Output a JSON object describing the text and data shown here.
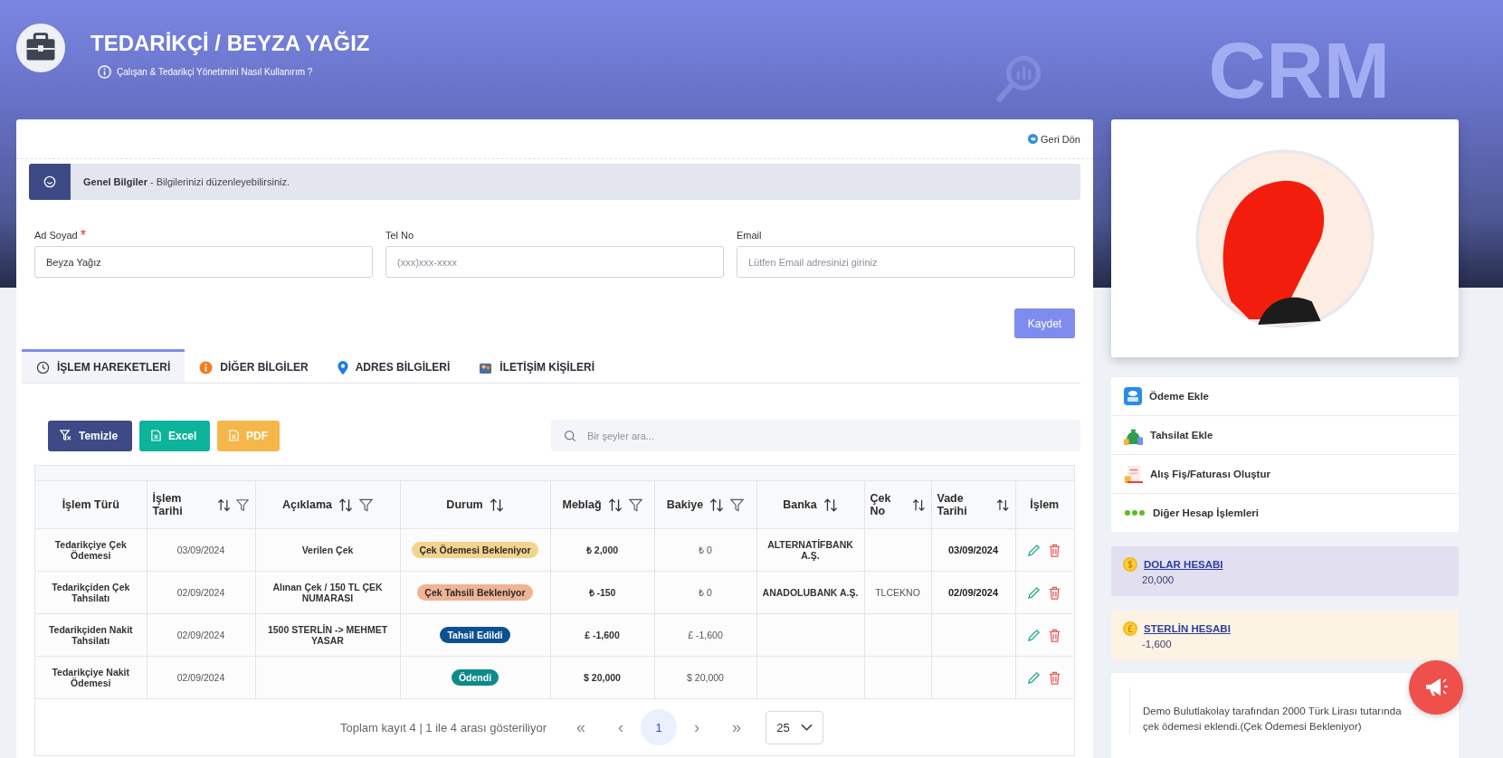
{
  "header": {
    "title": "TEDARİKÇİ / BEYZA YAĞIZ",
    "help_link": "Çalışan & Tedarikçi Yönetimini Nasıl Kullanırım ?",
    "decoration_text": "CRM"
  },
  "back_link": "Geri Dön",
  "section": {
    "title": "Genel Bilgiler",
    "subtitle": "- Bilgilerinizi düzenleyebilirsiniz."
  },
  "form": {
    "fields": [
      {
        "label": "Ad Soyad",
        "required": true,
        "value": "Beyza Yağız"
      },
      {
        "label": "Tel No",
        "required": false,
        "placeholder": "(xxx)xxx-xxxx"
      },
      {
        "label": "Email",
        "required": false,
        "placeholder": "Lütfen Email adresinizi giriniz"
      }
    ],
    "save_button": "Kaydet"
  },
  "tabs": [
    {
      "label": "İŞLEM HAREKETLERİ",
      "selected": true,
      "kind": "history"
    },
    {
      "label": "DİĞER BİLGİLER",
      "selected": false,
      "kind": "info"
    },
    {
      "label": "ADRES BİLGİLERİ",
      "selected": false,
      "kind": "location"
    },
    {
      "label": "İLETİŞİM KİŞİLERİ",
      "selected": false,
      "kind": "contacts"
    }
  ],
  "toolbar": {
    "buttons": [
      {
        "label": "Temizle",
        "kind": "clear"
      },
      {
        "label": "Excel",
        "kind": "excel"
      },
      {
        "label": "PDF",
        "kind": "pdf"
      }
    ],
    "search": {
      "placeholder": "Bir şeyler ara..."
    }
  },
  "table": {
    "columns": [
      {
        "label": "İşlem Türü",
        "sortable": false,
        "filterable": false
      },
      {
        "label": "İşlem Tarihi",
        "sortable": true,
        "filterable": true
      },
      {
        "label": "Açıklama",
        "sortable": true,
        "filterable": true
      },
      {
        "label": "Durum",
        "sortable": true,
        "filterable": false
      },
      {
        "label": "Meblağ",
        "sortable": true,
        "filterable": true
      },
      {
        "label": "Bakiye",
        "sortable": true,
        "filterable": true
      },
      {
        "label": "Banka",
        "sortable": true,
        "filterable": false
      },
      {
        "label": "Çek No",
        "sortable": true,
        "filterable": false
      },
      {
        "label": "Vade Tarihi",
        "sortable": true,
        "filterable": false
      },
      {
        "label": "İşlem",
        "sortable": false,
        "filterable": false
      }
    ],
    "rows": [
      {
        "type": "Tedarikçiye Çek Ödemesi",
        "date": "03/09/2024",
        "description": "Verilen Çek",
        "status": {
          "label": "Çek Ödemesi Bekleniyor",
          "color": "#f2d48c"
        },
        "amount": "₺ 2,000",
        "balance": "₺ 0",
        "bank": "ALTERNATİFBANK A.Ş.",
        "check_no": "",
        "due_date": "03/09/2024"
      },
      {
        "type": "Tedarikçiden Çek Tahsilatı",
        "date": "02/09/2024",
        "description": "Alınan Çek / 150 TL ÇEK NUMARASI",
        "status": {
          "label": "Çek Tahsili Bekleniyor",
          "color": "#f0b394"
        },
        "amount": "₺ -150",
        "balance": "₺ 0",
        "bank": "ANADOLUBANK A.Ş.",
        "check_no": "TLCEKNO",
        "due_date": "02/09/2024"
      },
      {
        "type": "Tedarikçiden Nakit Tahsilatı",
        "date": "02/09/2024",
        "description": "1500 STERLİN -> MEHMET YASAR",
        "status": {
          "label": "Tahsil Edildi",
          "color": "#0e4f94"
        },
        "amount": "£ -1,600",
        "balance": "£ -1,600",
        "bank": "",
        "check_no": "",
        "due_date": ""
      },
      {
        "type": "Tedarikçiye Nakit Ödemesi",
        "date": "02/09/2024",
        "description": "",
        "status": {
          "label": "Ödendi",
          "color": "#0f8a8a"
        },
        "amount": "$ 20,000",
        "balance": "$ 20,000",
        "bank": "",
        "check_no": "",
        "due_date": ""
      }
    ]
  },
  "pagination": {
    "summary": "Toplam kayıt 4 | 1 ile 4 arası gösteriliyor",
    "first": "«",
    "prev": "‹",
    "pages": [
      {
        "label": "1",
        "selected": true
      }
    ],
    "next": "›",
    "last": "»",
    "page_size": "25"
  },
  "side_actions": [
    {
      "label": "Ödeme Ekle",
      "kind": "payment"
    },
    {
      "label": "Tahsilat Ekle",
      "kind": "collection"
    },
    {
      "label": "Alış Fiş/Faturası Oluştur",
      "kind": "invoice"
    },
    {
      "label": "Diğer Hesap İşlemleri",
      "kind": "more"
    }
  ],
  "accounts": [
    {
      "name": "DOLAR HESABI",
      "amount": "20,000",
      "kind": "dollar",
      "color": "#e2dff0"
    },
    {
      "name": "STERLİN HESABI",
      "amount": "-1,600",
      "kind": "pound",
      "color": "#fcf3e3"
    }
  ],
  "notification": "Demo Bulutlakolay tarafından 2000 Türk Lirası tutarında çek ödemesi eklendi.(Çek Ödemesi Bekleniyor)"
}
